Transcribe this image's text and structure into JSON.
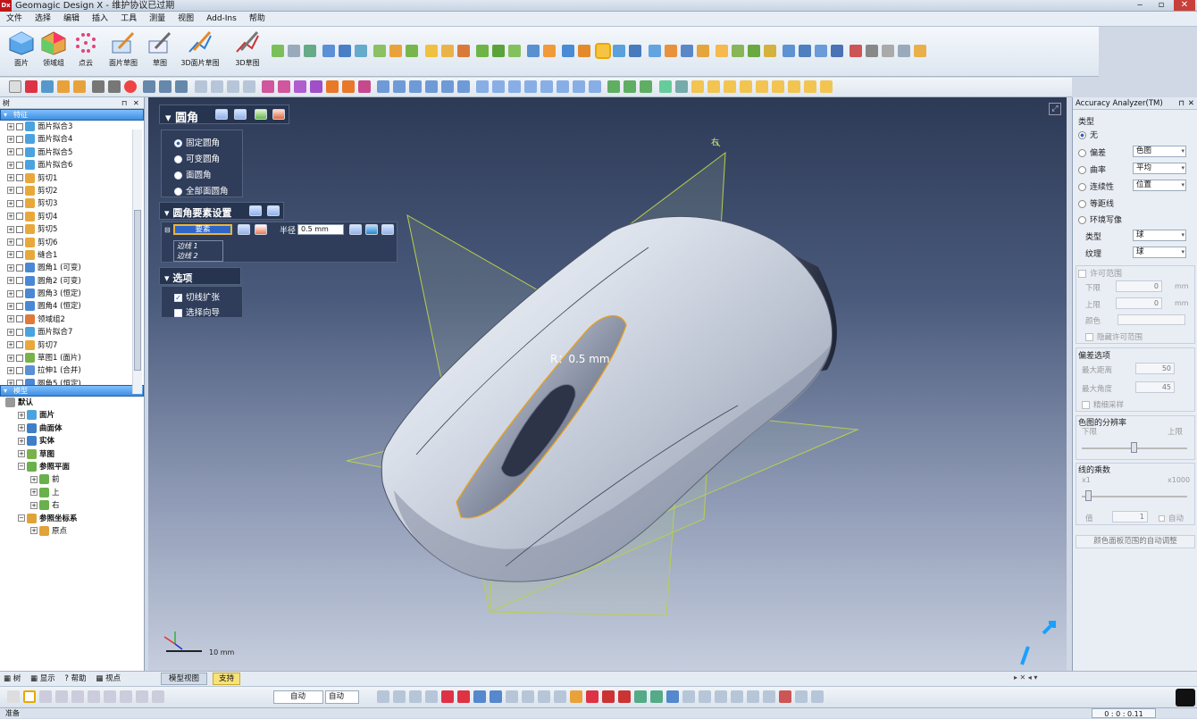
{
  "window": {
    "title": "Geomagic Design X - 维护协议已过期",
    "logo": "Dx"
  },
  "menu": [
    "文件",
    "选择",
    "编辑",
    "插入",
    "工具",
    "测量",
    "视图",
    "Add-Ins",
    "帮助"
  ],
  "ribbon": {
    "tools": [
      "面片",
      "领域组",
      "点云",
      "面片草图",
      "草图",
      "3D面片草图",
      "3D草图"
    ]
  },
  "tree": {
    "panel_title": "树",
    "features_header": "特征",
    "features": [
      "面片拟合3",
      "面片拟合4",
      "面片拟合5",
      "面片拟合6",
      "剪切1",
      "剪切2",
      "剪切3",
      "剪切4",
      "剪切5",
      "剪切6",
      "缝合1",
      "圆角1 (可变)",
      "圆角2 (可变)",
      "圆角3 (恒定)",
      "圆角4 (恒定)",
      "领域组2",
      "面片拟合7",
      "剪切7",
      "草图1 (面片)",
      "拉伸1 (合并)",
      "圆角5 (恒定)"
    ],
    "model_header": "模型",
    "model": [
      "默认",
      "面片",
      "曲面体",
      "实体",
      "草图",
      "参照平面",
      "前",
      "上",
      "右",
      "参照坐标系",
      "原点"
    ],
    "bottom_tabs": [
      "树",
      "显示",
      "帮助",
      "视点"
    ]
  },
  "dialog": {
    "fillet": {
      "title": "圆角",
      "options": [
        "固定圆角",
        "可变圆角",
        "面圆角",
        "全部面圆角"
      ],
      "selected": 0
    },
    "element_settings": {
      "title": "圆角要素设置",
      "element_label": "要素",
      "radius_label": "半径",
      "radius_value": "0.5 mm",
      "edges": [
        "边线 1",
        "边线 2"
      ]
    },
    "options": {
      "title": "选项",
      "items": [
        {
          "label": "切线扩张",
          "checked": true
        },
        {
          "label": "选择向导",
          "checked": false
        }
      ]
    }
  },
  "viewport": {
    "annotation": "R：0.5 mm",
    "plane_label": "右",
    "scale_label": "10 mm",
    "tabs": [
      "模型视图",
      "支持"
    ]
  },
  "right_panel": {
    "title": "Accuracy Analyzer(TM)",
    "type_label": "类型",
    "options": [
      "无",
      "偏差",
      "曲率",
      "连续性",
      "等距线",
      "环境写像"
    ],
    "option_values": {
      "偏差": "色图",
      "曲率": "平均",
      "连续性": "位置"
    },
    "type_field": {
      "label": "类型",
      "value": "球"
    },
    "texture_field": {
      "label": "纹理",
      "value": "球"
    },
    "tolerance": {
      "title": "许可范围",
      "lower_label": "下限",
      "lower": "0",
      "upper_label": "上限",
      "upper": "0",
      "unit": "mm",
      "color_label": "颜色",
      "hide_label": "隐藏许可范围"
    },
    "deviation": {
      "title": "偏差选项",
      "max_distance_label": "最大距离",
      "max_distance": "50",
      "max_angle_label": "最大角度",
      "max_angle": "45",
      "sampling_label": "精细采样"
    },
    "resolution": {
      "title": "色图的分辨率",
      "low": "下限",
      "high": "上限"
    },
    "line_coef": {
      "title": "线的乘数",
      "min": "x1",
      "max": "x1000",
      "value_label": "值",
      "value": "1",
      "auto_label": "自动"
    },
    "footer_button": "颜色面板范围的自动调整"
  },
  "bottom_toolbar": {
    "dropdown1": "自动",
    "dropdown2": "自动"
  },
  "status": {
    "left": "准备",
    "time": "0 : 0 : 0.11"
  }
}
